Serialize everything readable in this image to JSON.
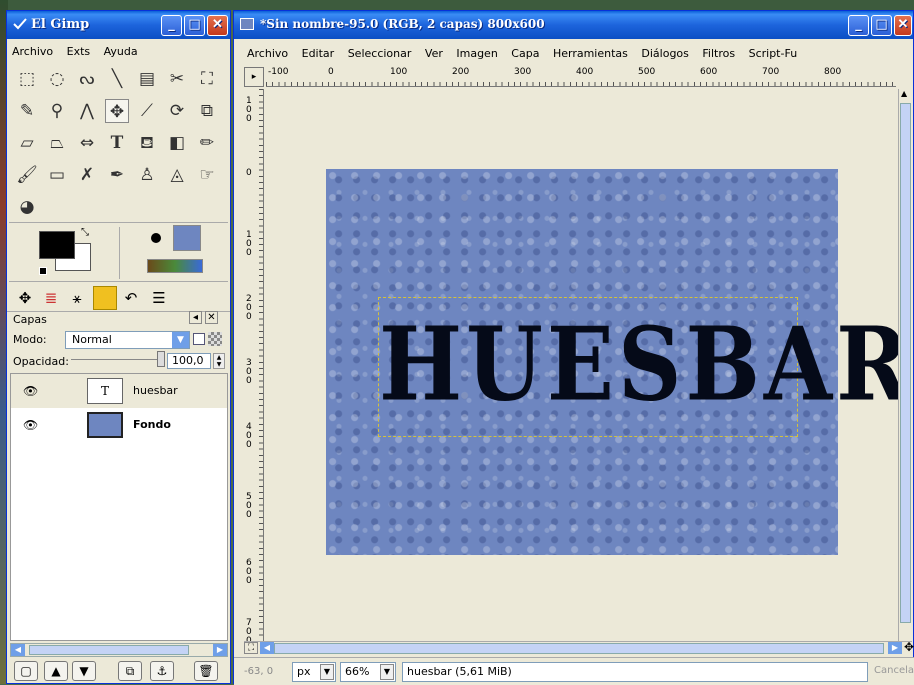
{
  "toolbox": {
    "title": "El Gimp",
    "menu": [
      "Archivo",
      "Exts",
      "Ayuda"
    ],
    "tools": [
      "rect-select",
      "ellipse-select",
      "free-select",
      "fuzzy-select",
      "select-by-color",
      "scissors",
      "foreground-select",
      "paths",
      "color-picker",
      "measure",
      "move",
      "crop",
      "rotate",
      "scale",
      "shear",
      "perspective",
      "flip",
      "text",
      "bucket-fill",
      "blend",
      "pencil",
      "paintbrush",
      "eraser",
      "airbrush",
      "ink",
      "clone",
      "heal",
      "smudge",
      "dodge-burn"
    ],
    "colors": {
      "foreground": "#000000",
      "background": "#ffffff",
      "pattern": "#6e86c0"
    }
  },
  "layers_dock": {
    "title": "Capas",
    "mode_label": "Modo:",
    "mode_value": "Normal",
    "opacity_label": "Opacidad:",
    "opacity_value": "100,0",
    "layers": [
      {
        "name": "huesbar",
        "type": "text",
        "bold": false
      },
      {
        "name": "Fondo",
        "type": "image",
        "bold": true
      }
    ]
  },
  "image_window": {
    "title": "*Sin nombre-95.0 (RGB, 2 capas) 800x600",
    "menu": [
      "Archivo",
      "Editar",
      "Seleccionar",
      "Ver",
      "Imagen",
      "Capa",
      "Herramientas",
      "Diálogos",
      "Filtros",
      "Script-Fu"
    ],
    "ruler_h_labels": [
      "-100",
      "0",
      "100",
      "200",
      "300",
      "400",
      "500",
      "600",
      "700",
      "800"
    ],
    "ruler_v_labels": [
      "100",
      "0",
      "100",
      "200",
      "300",
      "400",
      "500",
      "600",
      "700"
    ],
    "canvas_text": "HUESBAR",
    "status": {
      "coords": "-63, 0",
      "unit": "px",
      "zoom": "66%",
      "message": "huesbar (5,61 MiB)",
      "cancel": "Cancelar"
    }
  }
}
